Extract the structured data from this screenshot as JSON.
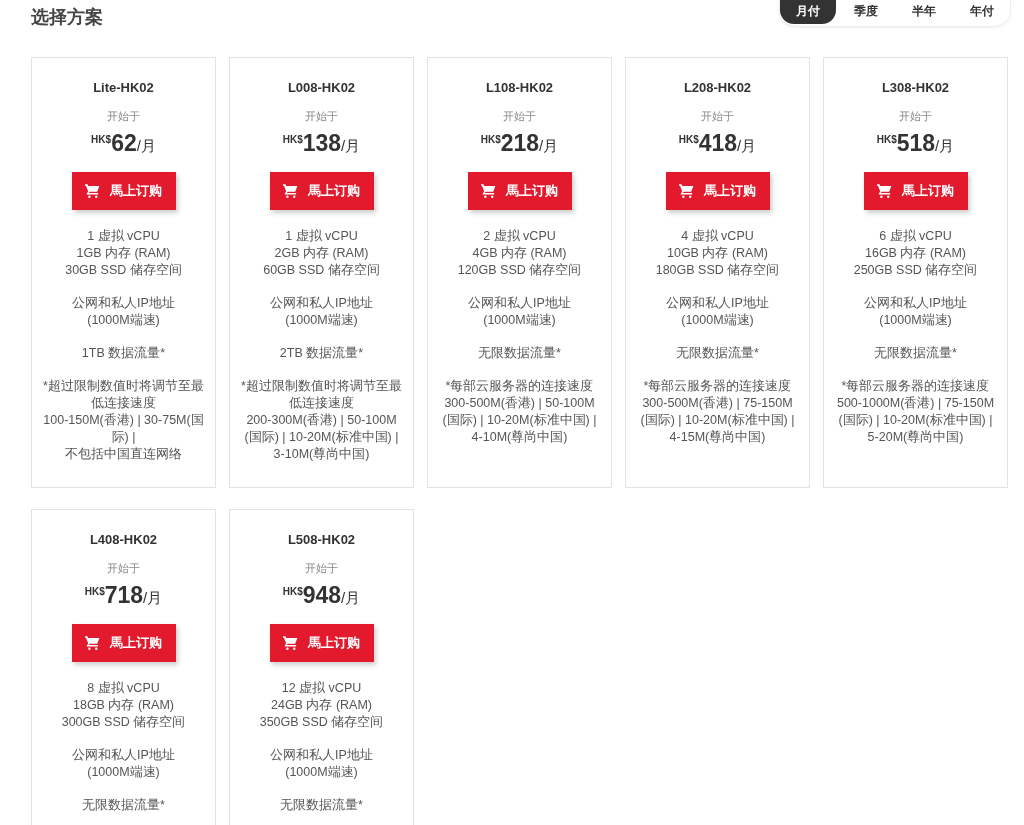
{
  "title": "选择方案",
  "billing_tabs": [
    {
      "label": "月付",
      "selected": true
    },
    {
      "label": "季度",
      "selected": false
    },
    {
      "label": "半年",
      "selected": false
    },
    {
      "label": "年付",
      "selected": false
    }
  ],
  "plans": [
    {
      "name": "Lite-HK02",
      "from_label": "开始于",
      "currency": "HK$",
      "price": "62",
      "unit": "/月",
      "button": "馬上订购",
      "spec_groups": [
        [
          "1 虚拟 vCPU",
          "1GB 内存 (RAM)",
          "30GB SSD 储存空间"
        ],
        [
          "公网和私人IP地址",
          "(1000M端速)"
        ],
        [
          "1TB 数据流量*"
        ],
        [
          "*超过限制数值时将调节至最低连接速度",
          "100-150M(香港) | 30-75M(国际) |",
          "不包括中国直连网络"
        ]
      ]
    },
    {
      "name": "L008-HK02",
      "from_label": "开始于",
      "currency": "HK$",
      "price": "138",
      "unit": "/月",
      "button": "馬上订购",
      "spec_groups": [
        [
          "1 虚拟 vCPU",
          "2GB 内存 (RAM)",
          "60GB SSD 储存空间"
        ],
        [
          "公网和私人IP地址",
          "(1000M端速)"
        ],
        [
          "2TB 数据流量*"
        ],
        [
          "*超过限制数值时将调节至最低连接速度",
          "200-300M(香港) | 50-100M (国际) | 10-20M(标准中国) | 3-10M(尊尚中国)"
        ]
      ]
    },
    {
      "name": "L108-HK02",
      "from_label": "开始于",
      "currency": "HK$",
      "price": "218",
      "unit": "/月",
      "button": "馬上订购",
      "spec_groups": [
        [
          "2 虚拟 vCPU",
          "4GB 内存 (RAM)",
          "120GB SSD 储存空间"
        ],
        [
          "公网和私人IP地址",
          "(1000M端速)"
        ],
        [
          "无限数据流量*"
        ],
        [
          "*每部云服务器的连接速度",
          "300-500M(香港) | 50-100M (国际) | 10-20M(标准中国) | 4-10M(尊尚中国)"
        ]
      ]
    },
    {
      "name": "L208-HK02",
      "from_label": "开始于",
      "currency": "HK$",
      "price": "418",
      "unit": "/月",
      "button": "馬上订购",
      "spec_groups": [
        [
          "4 虚拟 vCPU",
          "10GB 内存 (RAM)",
          "180GB SSD 储存空间"
        ],
        [
          "公网和私人IP地址",
          "(1000M端速)"
        ],
        [
          "无限数据流量*"
        ],
        [
          "*每部云服务器的连接速度",
          "300-500M(香港) | 75-150M (国际) | 10-20M(标准中国) | 4-15M(尊尚中国)"
        ]
      ]
    },
    {
      "name": "L308-HK02",
      "from_label": "开始于",
      "currency": "HK$",
      "price": "518",
      "unit": "/月",
      "button": "馬上订购",
      "spec_groups": [
        [
          "6 虚拟 vCPU",
          "16GB 内存 (RAM)",
          "250GB SSD 储存空间"
        ],
        [
          "公网和私人IP地址",
          "(1000M端速)"
        ],
        [
          "无限数据流量*"
        ],
        [
          "*每部云服务器的连接速度",
          "500-1000M(香港) | 75-150M (国际) | 10-20M(标准中国) | 5-20M(尊尚中国)"
        ]
      ]
    },
    {
      "name": "L408-HK02",
      "from_label": "开始于",
      "currency": "HK$",
      "price": "718",
      "unit": "/月",
      "button": "馬上订购",
      "spec_groups": [
        [
          "8 虚拟 vCPU",
          "18GB 内存 (RAM)",
          "300GB SSD 储存空间"
        ],
        [
          "公网和私人IP地址",
          "(1000M端速)"
        ],
        [
          "无限数据流量*"
        ]
      ]
    },
    {
      "name": "L508-HK02",
      "from_label": "开始于",
      "currency": "HK$",
      "price": "948",
      "unit": "/月",
      "button": "馬上订购",
      "spec_groups": [
        [
          "12 虚拟 vCPU",
          "24GB 内存 (RAM)",
          "350GB SSD 储存空间"
        ],
        [
          "公网和私人IP地址",
          "(1000M端速)"
        ],
        [
          "无限数据流量*"
        ]
      ]
    }
  ]
}
